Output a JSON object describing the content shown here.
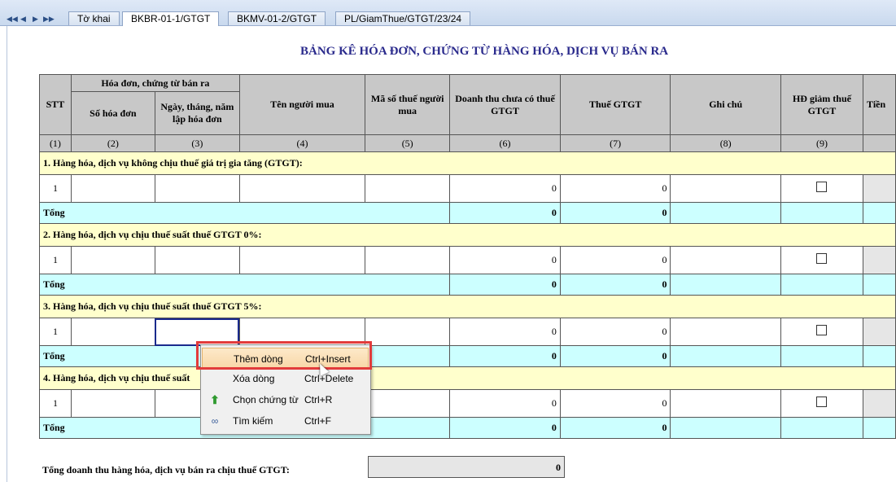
{
  "tabs": [
    {
      "label": "Tờ khai",
      "active": false
    },
    {
      "label": "BKBR-01-1/GTGT",
      "active": true
    },
    {
      "label": "BKMV-01-2/GTGT",
      "active": false
    },
    {
      "label": "PL/GiamThue/GTGT/23/24",
      "active": false
    }
  ],
  "nav": {
    "first": "◀◀",
    "prev": "◀",
    "next": "▶",
    "last": "▶▶"
  },
  "title": "BẢNG KÊ HÓA ĐƠN, CHỨNG TỪ HÀNG HÓA, DỊCH VỤ BÁN RA",
  "table": {
    "headers": {
      "stt": "STT",
      "group": "Hóa đơn, chứng từ bán ra",
      "so_hd": "Số hóa đơn",
      "ngay": "Ngày, tháng, năm lập hóa đơn",
      "ten": "Tên người mua",
      "mst": "Mã số thuế người mua",
      "doanh_thu": "Doanh thu chưa có thuế GTGT",
      "thue": "Thuế GTGT",
      "ghi_chu": "Ghi chú",
      "hd_giam": "HĐ giảm thuế GTGT",
      "tien": "Tiền"
    },
    "numbers": [
      "(1)",
      "(2)",
      "(3)",
      "(4)",
      "(5)",
      "(6)",
      "(7)",
      "(8)",
      "(9)"
    ],
    "sections": [
      {
        "title": "1. Hàng hóa, dịch vụ không chịu thuế giá trị gia tăng (GTGT):",
        "stt": "1",
        "doanh_thu": "0",
        "thue": "0",
        "total_label": "Tổng",
        "total_dt": "0",
        "total_thue": "0"
      },
      {
        "title": "2. Hàng hóa, dịch vụ chịu thuế suất thuế GTGT 0%:",
        "stt": "1",
        "doanh_thu": "0",
        "thue": "0",
        "total_label": "Tổng",
        "total_dt": "0",
        "total_thue": "0"
      },
      {
        "title": "3. Hàng hóa, dịch vụ chịu thuế suất thuế GTGT 5%:",
        "stt": "1",
        "doanh_thu": "0",
        "thue": "0",
        "total_label": "Tổng",
        "total_dt": "0",
        "total_thue": "0"
      },
      {
        "title": "4. Hàng hóa, dịch vụ chịu thuế suất",
        "stt": "1",
        "doanh_thu": "0",
        "thue": "0",
        "total_label": "Tổng",
        "total_dt": "0",
        "total_thue": "0"
      }
    ]
  },
  "footer": {
    "label": "Tổng doanh thu hàng hóa, dịch vụ bán ra chịu thuế GTGT:",
    "value": "0"
  },
  "context_menu": [
    {
      "label": "Thêm dòng",
      "shortcut": "Ctrl+Insert",
      "icon": "",
      "highlighted": true
    },
    {
      "label": "Xóa dòng",
      "shortcut": "Ctrl+Delete",
      "icon": ""
    },
    {
      "label": "Chọn chứng từ",
      "shortcut": "Ctrl+R",
      "icon": "green-up-arrow-icon"
    },
    {
      "label": "Tìm kiếm",
      "shortcut": "Ctrl+F",
      "icon": "binoculars-icon"
    }
  ]
}
